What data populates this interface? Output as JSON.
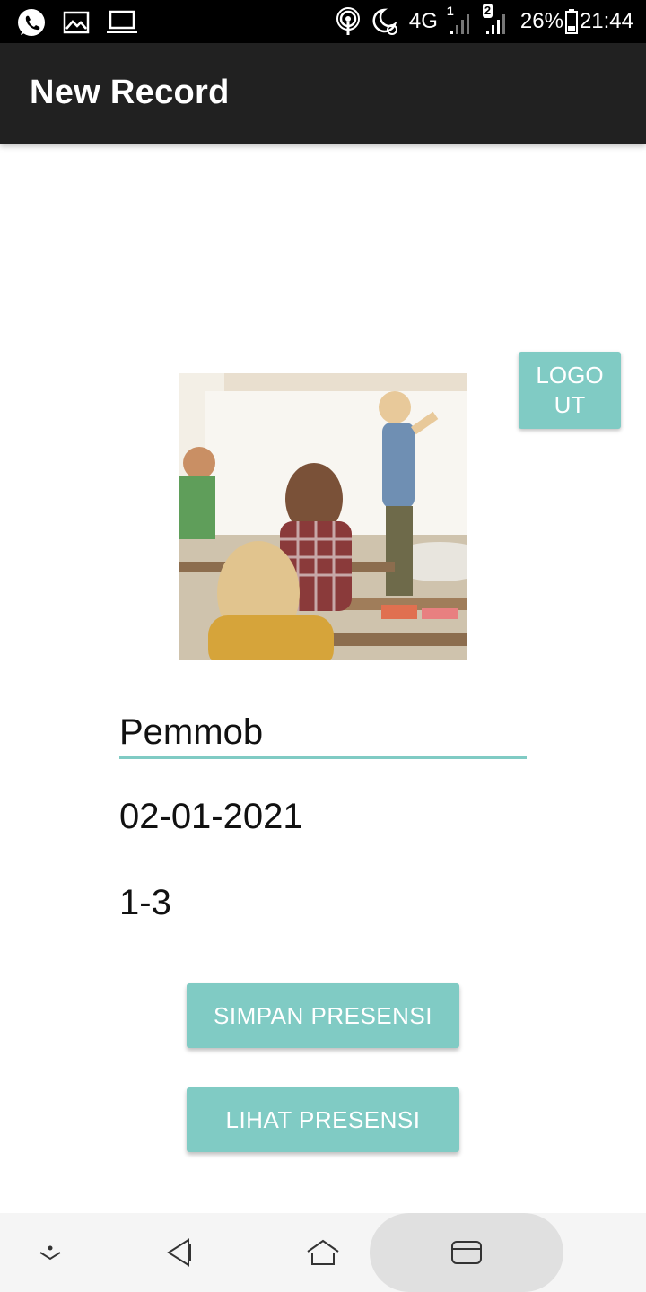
{
  "status_bar": {
    "icons_left": [
      "whatsapp-icon",
      "image-icon",
      "laptop-icon"
    ],
    "network": "4G",
    "sim1_label": "1",
    "sim2_label": "2",
    "battery": "26%",
    "time": "21:44"
  },
  "app_bar": {
    "title": "New Record"
  },
  "logout_button": {
    "label": "LOGO UT"
  },
  "form": {
    "course": "Pemmob",
    "date": "02-01-2021",
    "session": "1-3"
  },
  "buttons": {
    "save": "SIMPAN PRESENSI",
    "view": "LIHAT PRESENSI"
  },
  "colors": {
    "accent": "#80cbc4",
    "app_bar": "#212121",
    "status_bar": "#000000"
  }
}
